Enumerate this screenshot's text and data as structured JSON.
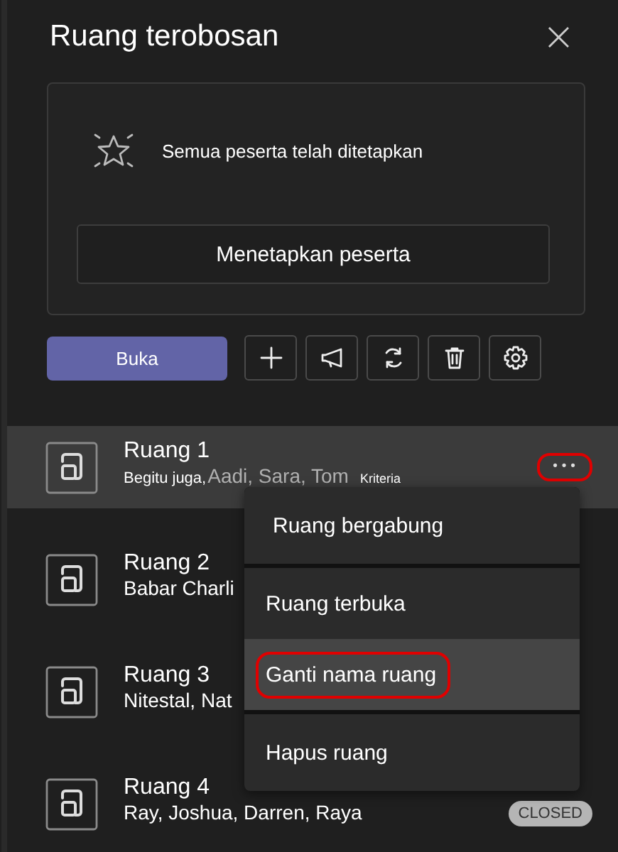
{
  "panel": {
    "title": "Ruang terobosan",
    "close": "×"
  },
  "assign_card": {
    "message": "Semua peserta telah ditetapkan",
    "button": "Menetapkan peserta"
  },
  "toolbar": {
    "primary": "Buka",
    "tools": [
      {
        "kind": "add"
      },
      {
        "kind": "announce"
      },
      {
        "kind": "recreate"
      },
      {
        "kind": "delete"
      },
      {
        "kind": "settings"
      }
    ]
  },
  "rooms": [
    {
      "name": "Ruang 1",
      "participants": "Begitu juga,",
      "others": "Aadi, Sara, Tom",
      "note": "Kriteria",
      "selected": true,
      "more": "•••",
      "annotated": true
    },
    {
      "name": "Ruang 2",
      "participants": "Babar Charli",
      "selected": false
    },
    {
      "name": "Ruang 3",
      "participants": "Nitestal, Nat",
      "selected": false
    },
    {
      "name": "Ruang 4",
      "participants": "Ray, Joshua, Darren, Raya",
      "status": "CLOSED",
      "selected": false
    }
  ],
  "menu": {
    "groups": [
      [
        {
          "label": "Ruang bergabung",
          "selected": false,
          "annotated": false
        }
      ],
      [
        {
          "label": "Ruang terbuka",
          "selected": false,
          "annotated": false
        },
        {
          "label": "Ganti nama ruang",
          "selected": true,
          "annotated": true
        }
      ],
      [
        {
          "label": "Hapus ruang",
          "selected": false,
          "annotated": false
        }
      ]
    ]
  }
}
